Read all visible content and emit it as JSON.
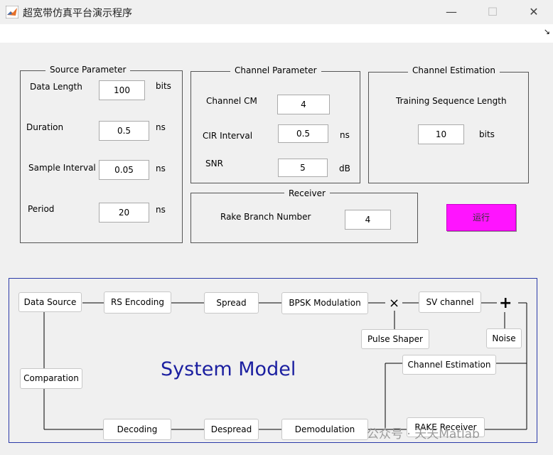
{
  "window": {
    "title": "超宽带仿真平台演示程序",
    "minimize_glyph": "—",
    "maximize_glyph": "☐",
    "close_glyph": "✕",
    "dock_glyph": "↘",
    "icon": "matlab-logo-icon"
  },
  "source_parameter": {
    "title": "Source Parameter",
    "data_length": {
      "label": "Data Length",
      "value": "100",
      "unit": "bits"
    },
    "duration": {
      "label": "Duration",
      "value": "0.5",
      "unit": "ns"
    },
    "sample_interval": {
      "label": "Sample Interval",
      "value": "0.05",
      "unit": "ns"
    },
    "period": {
      "label": "Period",
      "value": "20",
      "unit": "ns"
    }
  },
  "channel_parameter": {
    "title": "Channel Parameter",
    "channel_cm": {
      "label": "Channel CM",
      "value": "4"
    },
    "cir_interval": {
      "label": "CIR Interval",
      "value": "0.5",
      "unit": "ns"
    },
    "snr": {
      "label": "SNR",
      "value": "5",
      "unit": "dB"
    }
  },
  "channel_estimation": {
    "title": "Channel Estimation",
    "training_label": "Training Sequence Length",
    "training_value": "10",
    "training_unit": "bits"
  },
  "receiver": {
    "title": "Receiver",
    "rake_label": "Rake Branch Number",
    "rake_value": "4"
  },
  "run_button_label": "运行",
  "system_model": {
    "title": "System Model",
    "blocks": {
      "data_source": "Data Source",
      "rs_encoding": "RS Encoding",
      "spread": "Spread",
      "bpsk_modulation": "BPSK Modulation",
      "sv_channel": "SV channel",
      "pulse_shaper": "Pulse Shaper",
      "noise": "Noise",
      "channel_estimation": "Channel Estimation",
      "comparation": "Comparation",
      "rake_receiver": "RAKE Receiver",
      "demodulation": "Demodulation",
      "despread": "Despread",
      "decoding": "Decoding"
    },
    "multiply_symbol": "×",
    "add_symbol": "+"
  },
  "watermark": "公众号 · 天天Matlab"
}
